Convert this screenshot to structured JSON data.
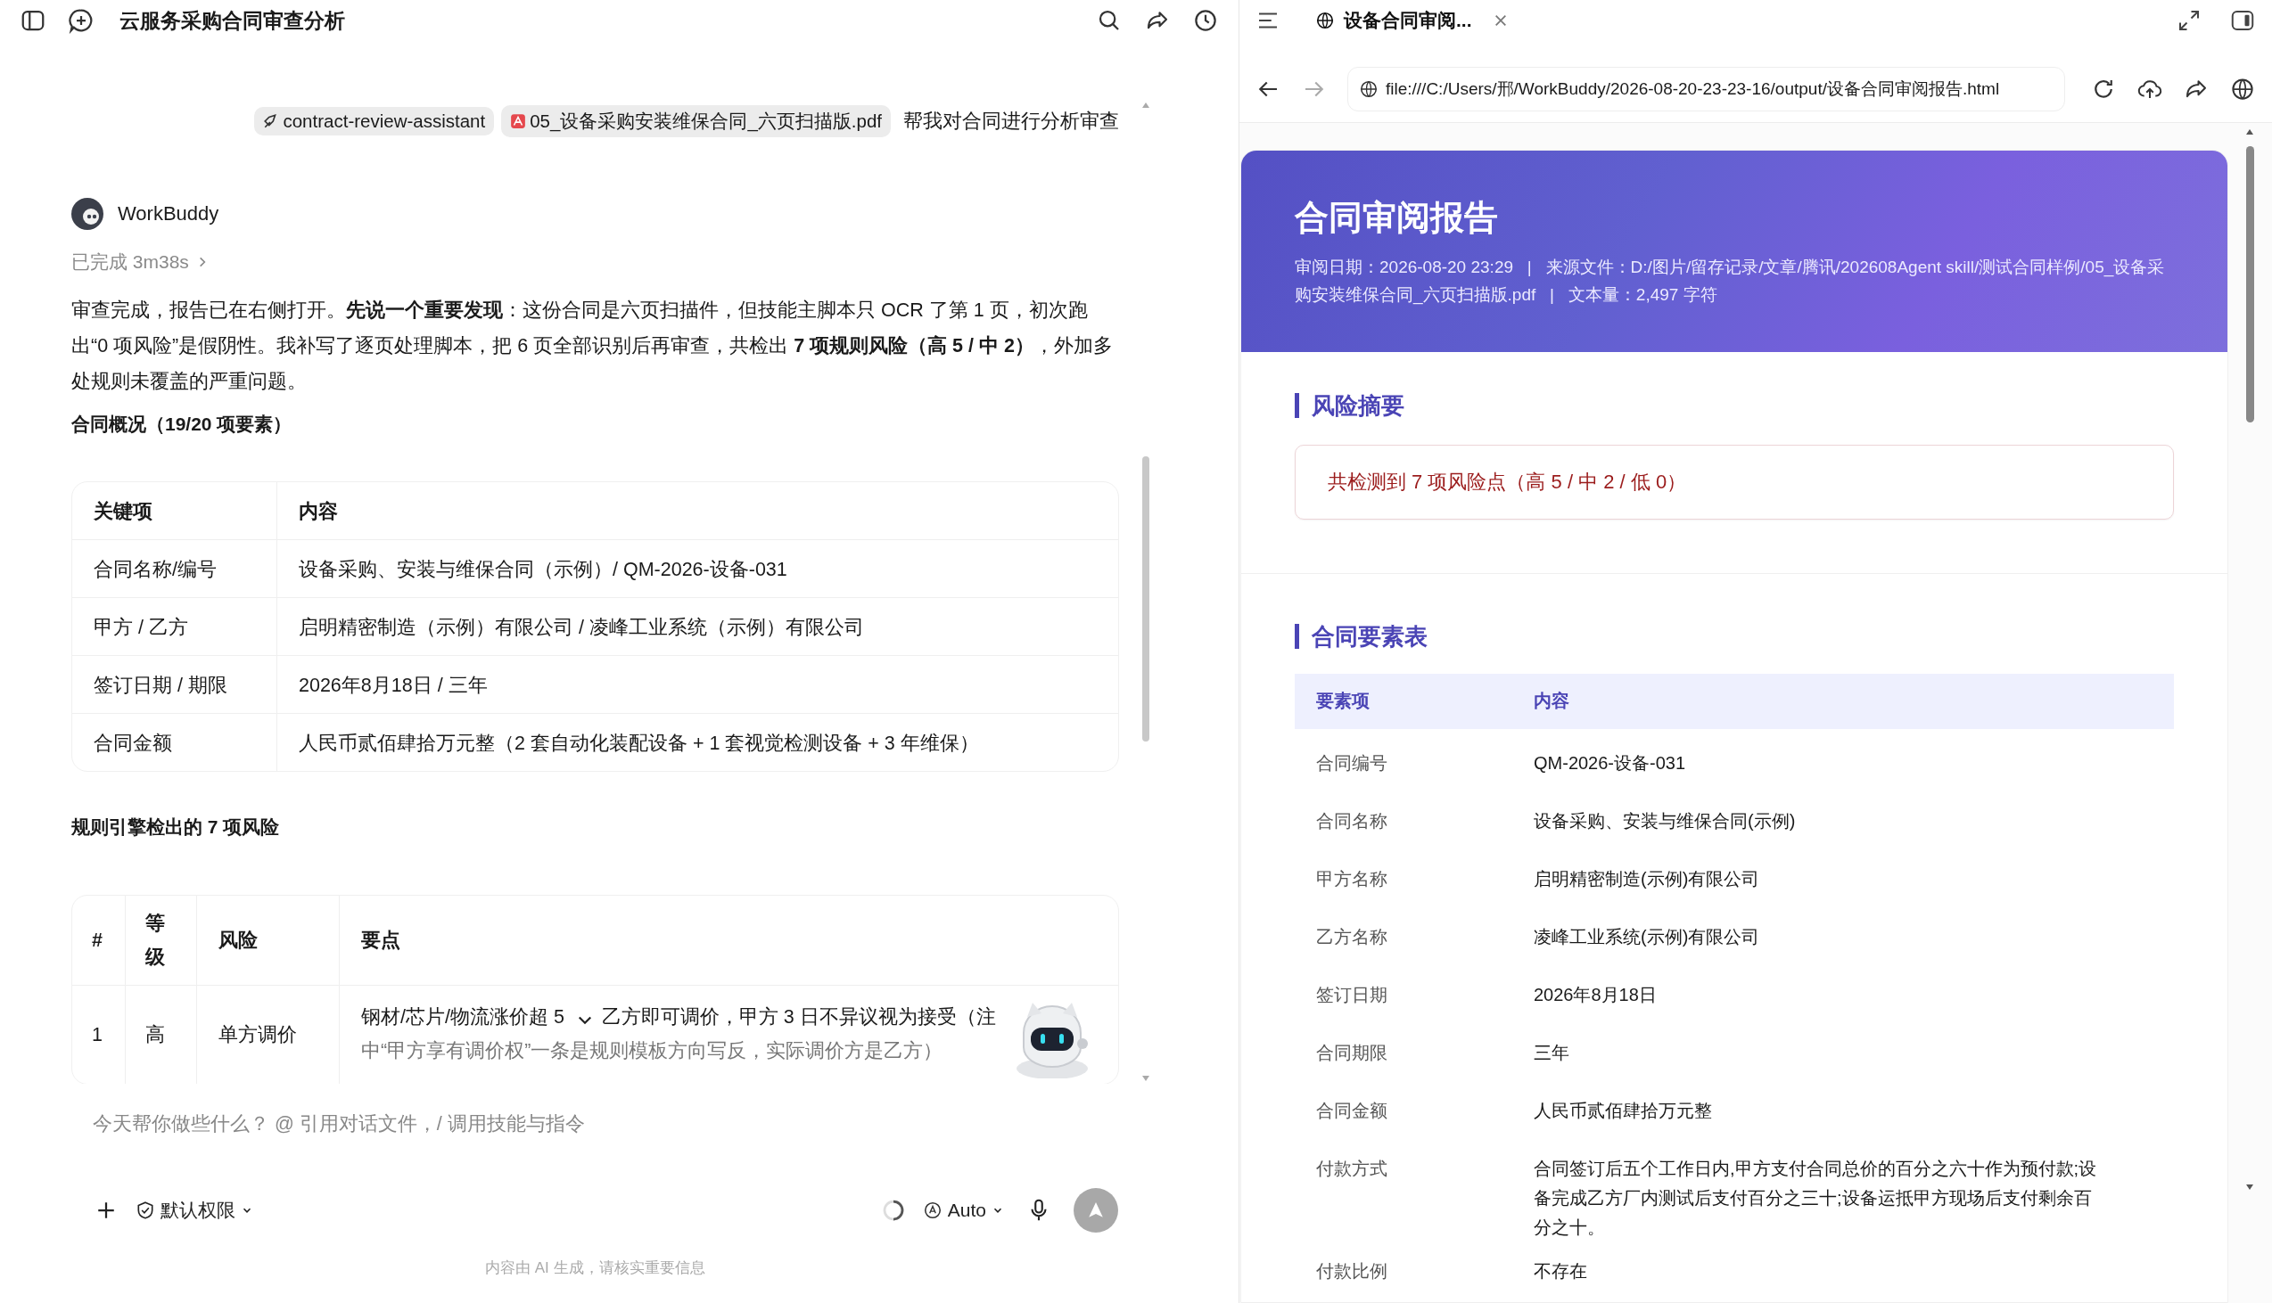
{
  "chat": {
    "title": "云服务采购合同审查分析",
    "user_message": {
      "chips": [
        {
          "kind": "skill",
          "label": "contract-review-assistant"
        },
        {
          "kind": "pdf",
          "label": "05_设备采购安装维保合同_六页扫描版.pdf"
        }
      ],
      "text": "帮我对合同进行分析审查"
    },
    "assistant": {
      "name": "WorkBuddy",
      "status": "已完成 3m38s",
      "paragraph": "审查完成，报告已在右侧打开。**先说一个重要发现**：这份合同是六页扫描件，但技能主脚本只 OCR 了第 1 页，初次跑出“0 项风险”是假阴性。我补写了逐页处理脚本，把 6 页全部识别后再审查，共检出 **7 项规则风险（高 5 / 中 2）**，外加多处规则未覆盖的严重问题。",
      "overview_heading": "合同概况（19/20 项要素）",
      "overview_table": {
        "columns": [
          "关键项",
          "内容"
        ],
        "rows": [
          [
            "合同名称/编号",
            "设备采购、安装与维保合同（示例）/ QM-2026-设备-031"
          ],
          [
            "甲方 / 乙方",
            "启明精密制造（示例）有限公司 / 凌峰工业系统（示例）有限公司"
          ],
          [
            "签订日期 / 期限",
            "2026年8月18日 / 三年"
          ],
          [
            "合同金额",
            "人民币贰佰肆拾万元整（2 套自动化装配设备 + 1 套视觉检测设备 + 3 年维保）"
          ]
        ]
      },
      "risks_heading": "规则引擎检出的 7 项风险",
      "risk_table": {
        "columns": [
          "#",
          "等级",
          "风险",
          "要点"
        ],
        "rows": [
          {
            "number": "1",
            "grade": "高",
            "risk": "单方调价",
            "points": [
              "钢材/芯片/物流涨价超 5",
              "乙方即可调价，甲方 3 日不异议视为接受（注",
              "中“甲方享有调价权”一条是规则模板方向写反，实际调价方是乙方）"
            ]
          }
        ]
      }
    },
    "composer": {
      "placeholder": "今天帮你做些什么？ @ 引用对话文件，/ 调用技能与指令",
      "permission": "默认权限",
      "model": "Auto",
      "footer": "内容由 AI 生成，请核实重要信息"
    }
  },
  "browser": {
    "tabs": [
      {
        "title": "设备合同审阅...",
        "selected": true
      }
    ],
    "url": "file:///C:/Users/邢/WorkBuddy/2026-08-20-23-23-16/output/设备合同审阅报告.html",
    "report": {
      "title": "合同审阅报告",
      "meta": "审阅日期：2026-08-20 23:29   |   来源文件：D:/图片/留存记录/文章/腾讯/202608Agent skill/测试合同样例/05_设备采购安装维保合同_六页扫描版.pdf   |   文本量：2,497 字符",
      "summary_heading": "风险摘要",
      "summary": "共检测到 7 项风险点（高 5 / 中 2 / 低 0）",
      "elements_heading": "合同要素表",
      "elements_columns": [
        "要素项",
        "内容"
      ],
      "elements": [
        [
          "合同编号",
          "QM-2026-设备-031"
        ],
        [
          "合同名称",
          "设备采购、安装与维保合同(示例)"
        ],
        [
          "甲方名称",
          "启明精密制造(示例)有限公司"
        ],
        [
          "乙方名称",
          "凌峰工业系统(示例)有限公司"
        ],
        [
          "签订日期",
          "2026年8月18日"
        ],
        [
          "合同期限",
          "三年"
        ],
        [
          "合同金额",
          "人民币贰佰肆拾万元整"
        ],
        [
          "付款方式",
          "合同签订后五个工作日内,甲方支付合同总价的百分之六十作为预付款;设备完成乙方厂内测试后支付百分之三十;设备运抵甲方现场后支付剩余百分之十。"
        ],
        [
          "付款比例",
          "不存在"
        ]
      ]
    }
  }
}
